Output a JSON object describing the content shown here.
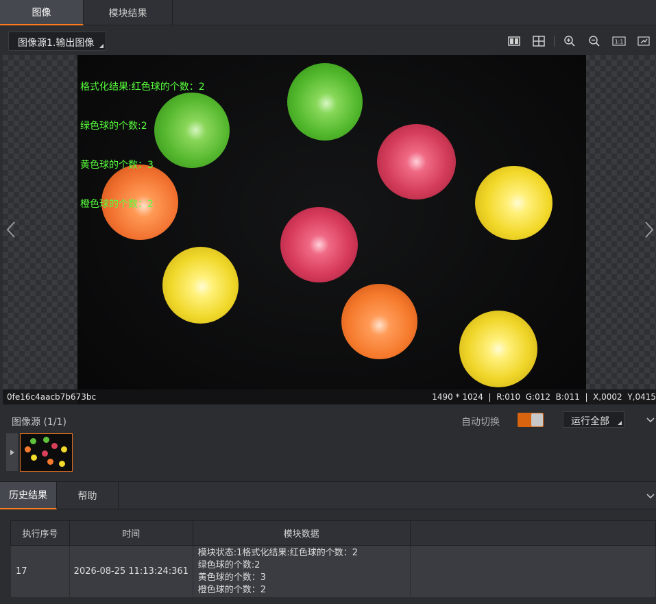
{
  "top_tabs": [
    "图像",
    "模块结果"
  ],
  "toolbar": {
    "source_select": "图像源1.输出图像",
    "icons": [
      "split-view-icon",
      "grid-icon",
      "zoom-in-icon",
      "zoom-out-icon",
      "actual-size-icon",
      "fit-icon"
    ],
    "actual_size_label": "1:1"
  },
  "viewer": {
    "overlay_lines": [
      "格式化结果:红色球的个数：2",
      "绿色球的个数:2",
      "黄色球的个数：3",
      "橙色球的个数：2"
    ],
    "image_id": "0fe16c4aacb7b673bc",
    "status": "1490 * 1024  |  R:010  G:012  B:011  |  X,0002  Y,0415"
  },
  "image_source": {
    "title": "图像源 (1/1)",
    "auto_switch_label": "自动切换",
    "auto_switch_on": true,
    "run_select": "运行全部"
  },
  "history": {
    "tabs": [
      "历史结果",
      "帮助"
    ],
    "headers": [
      "执行序号",
      "时间",
      "模块数据"
    ],
    "rows": [
      {
        "index": "17",
        "time": "2026-08-25 11:13:24:361",
        "data": "模块状态:1格式化结果:红色球的个数：2\n绿色球的个数:2\n黄色球的个数：3\n橙色球的个数：2"
      }
    ]
  },
  "colors": {
    "accent": "#ff7a1a",
    "overlay_text": "#58ff3c",
    "green_ball": "#5fc23a",
    "red_ball": "#d8405a",
    "yellow_ball": "#f2d92a",
    "orange_ball": "#f57a2c"
  }
}
